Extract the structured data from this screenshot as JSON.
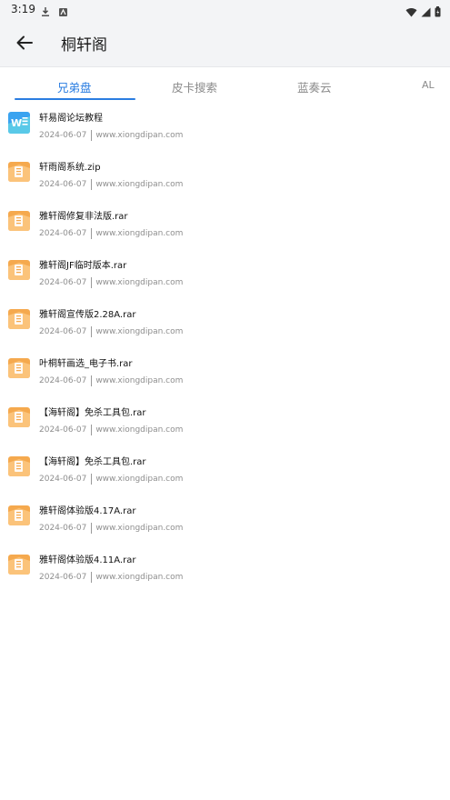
{
  "status": {
    "time": "3:19"
  },
  "appbar": {
    "title": "桐轩阁"
  },
  "tabs": [
    {
      "label": "兄弟盘",
      "active": true
    },
    {
      "label": "皮卡搜索",
      "active": false
    },
    {
      "label": "蓝奏云",
      "active": false
    },
    {
      "label": "AL",
      "active": false
    }
  ],
  "files": [
    {
      "name": "轩易阁论坛教程",
      "date": "2024-06-07",
      "source": "www.xiongdipan.com",
      "icon": "word-doc-icon"
    },
    {
      "name": "轩雨阁系统.zip",
      "date": "2024-06-07",
      "source": "www.xiongdipan.com",
      "icon": "archive-icon"
    },
    {
      "name": "雅轩阁修复非法版.rar",
      "date": "2024-06-07",
      "source": "www.xiongdipan.com",
      "icon": "archive-icon"
    },
    {
      "name": "雅轩阁JF临时版本.rar",
      "date": "2024-06-07",
      "source": "www.xiongdipan.com",
      "icon": "archive-icon"
    },
    {
      "name": "雅轩阁宣传版2.28A.rar",
      "date": "2024-06-07",
      "source": "www.xiongdipan.com",
      "icon": "archive-icon"
    },
    {
      "name": "叶桐轩画选_电子书.rar",
      "date": "2024-06-07",
      "source": "www.xiongdipan.com",
      "icon": "archive-icon"
    },
    {
      "name": "【海轩阁】免杀工具包.rar",
      "date": "2024-06-07",
      "source": "www.xiongdipan.com",
      "icon": "archive-icon"
    },
    {
      "name": "【海轩阁】免杀工具包.rar",
      "date": "2024-06-07",
      "source": "www.xiongdipan.com",
      "icon": "archive-icon"
    },
    {
      "name": "雅轩阁体验版4.17A.rar",
      "date": "2024-06-07",
      "source": "www.xiongdipan.com",
      "icon": "archive-icon"
    },
    {
      "name": "雅轩阁体验版4.11A.rar",
      "date": "2024-06-07",
      "source": "www.xiongdipan.com",
      "icon": "archive-icon"
    }
  ],
  "colors": {
    "accent": "#2a7de1",
    "archive": "#f5a94e",
    "word": "#3aa3f0"
  }
}
